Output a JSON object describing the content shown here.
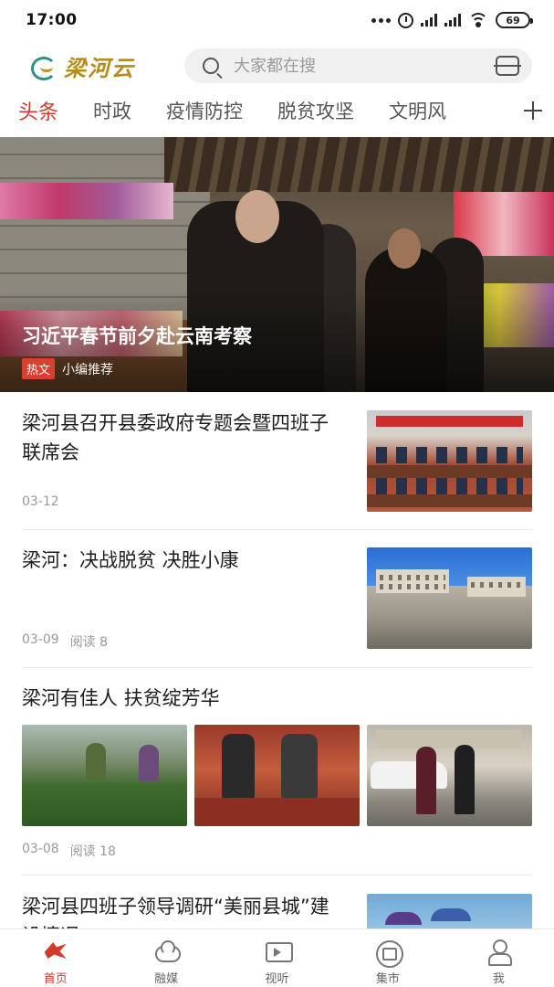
{
  "status_bar": {
    "time": "17:00",
    "battery": "69"
  },
  "header": {
    "logo_text": "梁河云",
    "search_placeholder": "大家都在搜"
  },
  "tabs": [
    "头条",
    "时政",
    "疫情防控",
    "脱贫攻坚",
    "文明风"
  ],
  "hero": {
    "title": "习近平春节前夕赴云南考察",
    "tag": "热文",
    "source": "小编推荐"
  },
  "news": [
    {
      "title": "梁河县召开县委政府专题会暨四班子联席会",
      "date": "03-12",
      "reads": ""
    },
    {
      "title": "梁河：决战脱贫 决胜小康",
      "date": "03-09",
      "reads": "阅读 8"
    },
    {
      "title": "梁河有佳人 扶贫绽芳华",
      "date": "03-08",
      "reads": "阅读 18"
    },
    {
      "title": "梁河县四班子领导调研“美丽县城”建设情况",
      "date": "",
      "reads": ""
    }
  ],
  "bottom_nav": [
    {
      "label": "首页",
      "icon": "home-icon",
      "active": true
    },
    {
      "label": "融媒",
      "icon": "cloud-icon",
      "active": false
    },
    {
      "label": "视听",
      "icon": "tv-play-icon",
      "active": false
    },
    {
      "label": "集市",
      "icon": "market-bag-icon",
      "active": false
    },
    {
      "label": "我",
      "icon": "user-icon",
      "active": false
    }
  ],
  "colors": {
    "accent": "#d23a2b",
    "logo": "#b88a1a",
    "search_bg": "#f0f0f0"
  }
}
